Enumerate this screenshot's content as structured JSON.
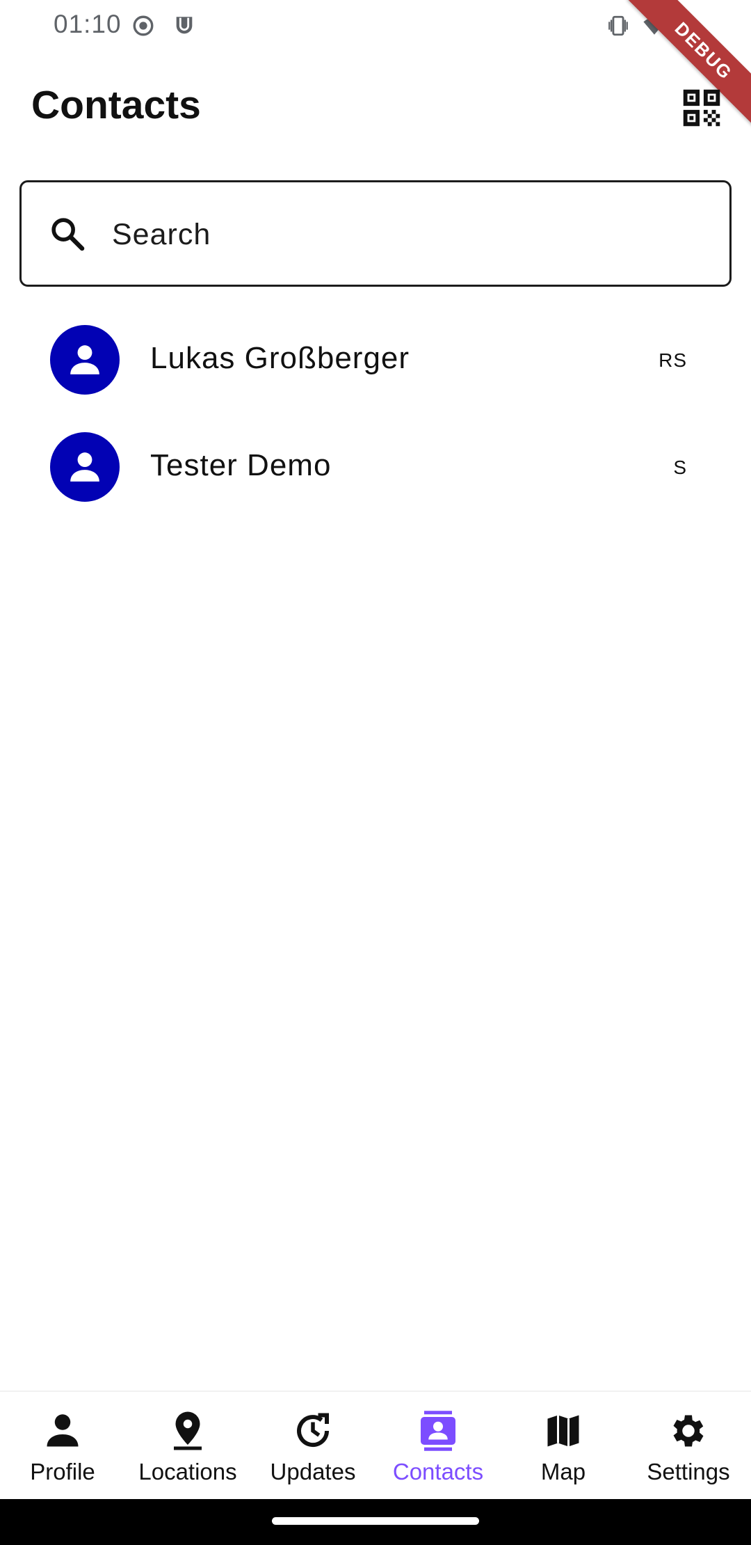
{
  "status_bar": {
    "time": "01:10",
    "icons": [
      "record-icon",
      "notification-app-icon",
      "vibrate-icon",
      "wifi-icon",
      "battery-icon"
    ]
  },
  "debug_banner": "DEBUG",
  "app_bar": {
    "title": "Contacts",
    "action_icon": "qr-code-icon"
  },
  "search": {
    "placeholder": "Search",
    "value": ""
  },
  "contacts": [
    {
      "name": "Lukas Großberger",
      "trailing": "RS"
    },
    {
      "name": "Tester Demo",
      "trailing": "S"
    }
  ],
  "bottom_nav": [
    {
      "label": "Profile",
      "icon": "person-icon",
      "active": false
    },
    {
      "label": "Locations",
      "icon": "location-pin-icon",
      "active": false
    },
    {
      "label": "Updates",
      "icon": "update-clock-icon",
      "active": false
    },
    {
      "label": "Contacts",
      "icon": "contacts-icon",
      "active": true
    },
    {
      "label": "Map",
      "icon": "map-icon",
      "active": false
    },
    {
      "label": "Settings",
      "icon": "gear-icon",
      "active": false
    }
  ],
  "colors": {
    "avatar": "#0202b4",
    "accent": "#7c4dff",
    "debug_banner": "#b33a3a"
  }
}
